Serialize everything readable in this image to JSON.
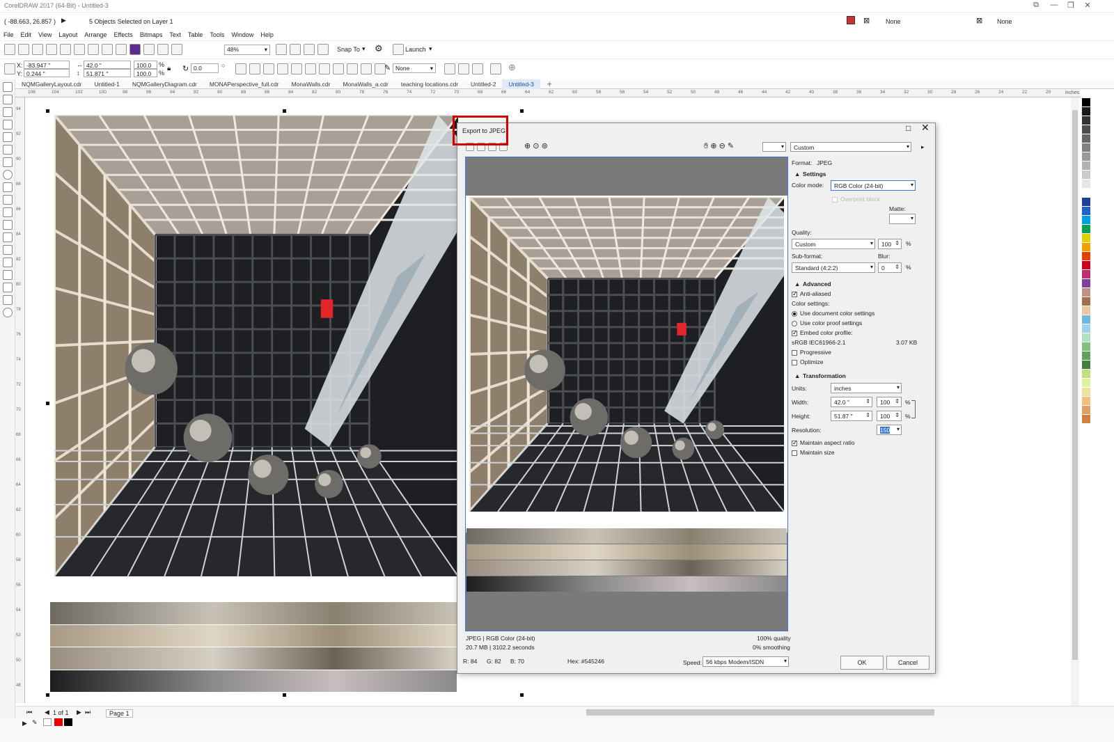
{
  "window": {
    "title": "CorelDRAW 2017 (64-Bit) - Untitled-3",
    "coords": "( -88.663, 26.857 )",
    "selection_status": "5 Objects Selected on Layer 1",
    "fill_label": "None",
    "outline_label": "None"
  },
  "menu": [
    "File",
    "Edit",
    "View",
    "Layout",
    "Arrange",
    "Effects",
    "Bitmaps",
    "Text",
    "Table",
    "Tools",
    "Window",
    "Help"
  ],
  "toolbar": {
    "zoom": "48%",
    "snap_to": "Snap To",
    "launch": "Launch"
  },
  "propbar": {
    "x": "-83.947 \"",
    "y": "0.244 \"",
    "w": "42.0 \"",
    "h": "51.871 \"",
    "sx": "100.0",
    "sy": "100.0",
    "pct": "%",
    "angle": "0.0",
    "outline": "None"
  },
  "tabs": [
    "NQMGalleryLayout.cdr",
    "Untitled-1",
    "NQMGalleryDiagram.cdr",
    "MONAPerspective_full.cdr",
    "MonaWalls.cdr",
    "MonaWalls_a.cdr",
    "teaching locations.cdr",
    "Untitled-2",
    "Untitled-3"
  ],
  "ruler_ticks": [
    "106",
    "104",
    "102",
    "100",
    "98",
    "96",
    "94",
    "92",
    "90",
    "88",
    "86",
    "84",
    "82",
    "80",
    "78",
    "76",
    "74",
    "72",
    "70",
    "68",
    "66",
    "64",
    "62",
    "60",
    "58",
    "56",
    "54",
    "52",
    "50",
    "48",
    "46",
    "44",
    "42",
    "40",
    "38",
    "36",
    "34",
    "32",
    "30",
    "28",
    "26",
    "24",
    "22",
    "20"
  ],
  "ruler_unit": "inches",
  "vruler_ticks": [
    "94",
    "92",
    "90",
    "88",
    "86",
    "84",
    "82",
    "80",
    "78",
    "76",
    "74",
    "72",
    "70",
    "68",
    "66",
    "64",
    "62",
    "60",
    "58",
    "56",
    "54",
    "52",
    "50",
    "48"
  ],
  "page_nav": {
    "page_of": "1 of 1",
    "page_tab": "Page 1"
  },
  "dialog": {
    "title": "Export to JPEG",
    "preset": "Custom",
    "format_label": "Format:",
    "format_value": "JPEG",
    "settings_head": "Settings",
    "color_mode_label": "Color mode:",
    "color_mode_value": "RGB Color (24-bit)",
    "overprint_black": "Overprint black",
    "matte_label": "Matte:",
    "quality_label": "Quality:",
    "quality_value": "Custom",
    "quality_num": "100",
    "pct": "%",
    "subformat_label": "Sub-format:",
    "subformat_value": "Standard (4:2:2)",
    "blur_label": "Blur:",
    "blur_value": "0",
    "advanced_head": "Advanced",
    "anti_aliased": "Anti-aliased",
    "color_settings_label": "Color settings:",
    "use_document": "Use document color settings",
    "use_proof": "Use color proof settings",
    "embed_profile": "Embed color profile:",
    "profile_name": "sRGB IEC61966-2.1",
    "profile_size": "3.07 KB",
    "progressive": "Progressive",
    "optimize": "Optimize",
    "transformation_head": "Transformation",
    "units_label": "Units:",
    "units_value": "inches",
    "width_label": "Width:",
    "width_value": "42.0 \"",
    "width_pct": "100",
    "height_label": "Height:",
    "height_value": "51.87 \"",
    "height_pct": "100",
    "resolution_label": "Resolution:",
    "resolution_value": "150",
    "maintain_aspect": "Maintain aspect ratio",
    "maintain_size": "Maintain size",
    "info_left_1": "JPEG  |  RGB Color (24-bit)",
    "info_left_2": "20.7 MB  |  3102.2 seconds",
    "info_right_1": "100% quality",
    "info_right_2": "0% smoothing",
    "r": "R: 84",
    "g": "G: 82",
    "b": "B: 70",
    "hex": "Hex: #545246",
    "speed_label": "Speed:",
    "speed_value": "56 kbps Modem/ISDN",
    "ok": "OK",
    "cancel": "Cancel"
  },
  "colors": {
    "accent_red": "#d40000",
    "selection_blue": "#3b78d8",
    "palette": [
      "#000000",
      "#1a1a1a",
      "#333333",
      "#4d4d4d",
      "#666666",
      "#808080",
      "#999999",
      "#b3b3b3",
      "#cccccc",
      "#e6e6e6",
      "#ffffff",
      "#1f3f99",
      "#2060c8",
      "#00a0e0",
      "#00a050",
      "#e0d000",
      "#f0a000",
      "#e04000",
      "#d00020",
      "#c03070",
      "#8040a0",
      "#c09080",
      "#a07050",
      "#e8c8a0",
      "#70b8e0",
      "#a0d0f0",
      "#b0e0c0",
      "#80c080",
      "#60a060",
      "#408040",
      "#c0e080",
      "#e0f0a0",
      "#f0e0a0",
      "#f0c080",
      "#e0a060",
      "#d08040"
    ]
  }
}
